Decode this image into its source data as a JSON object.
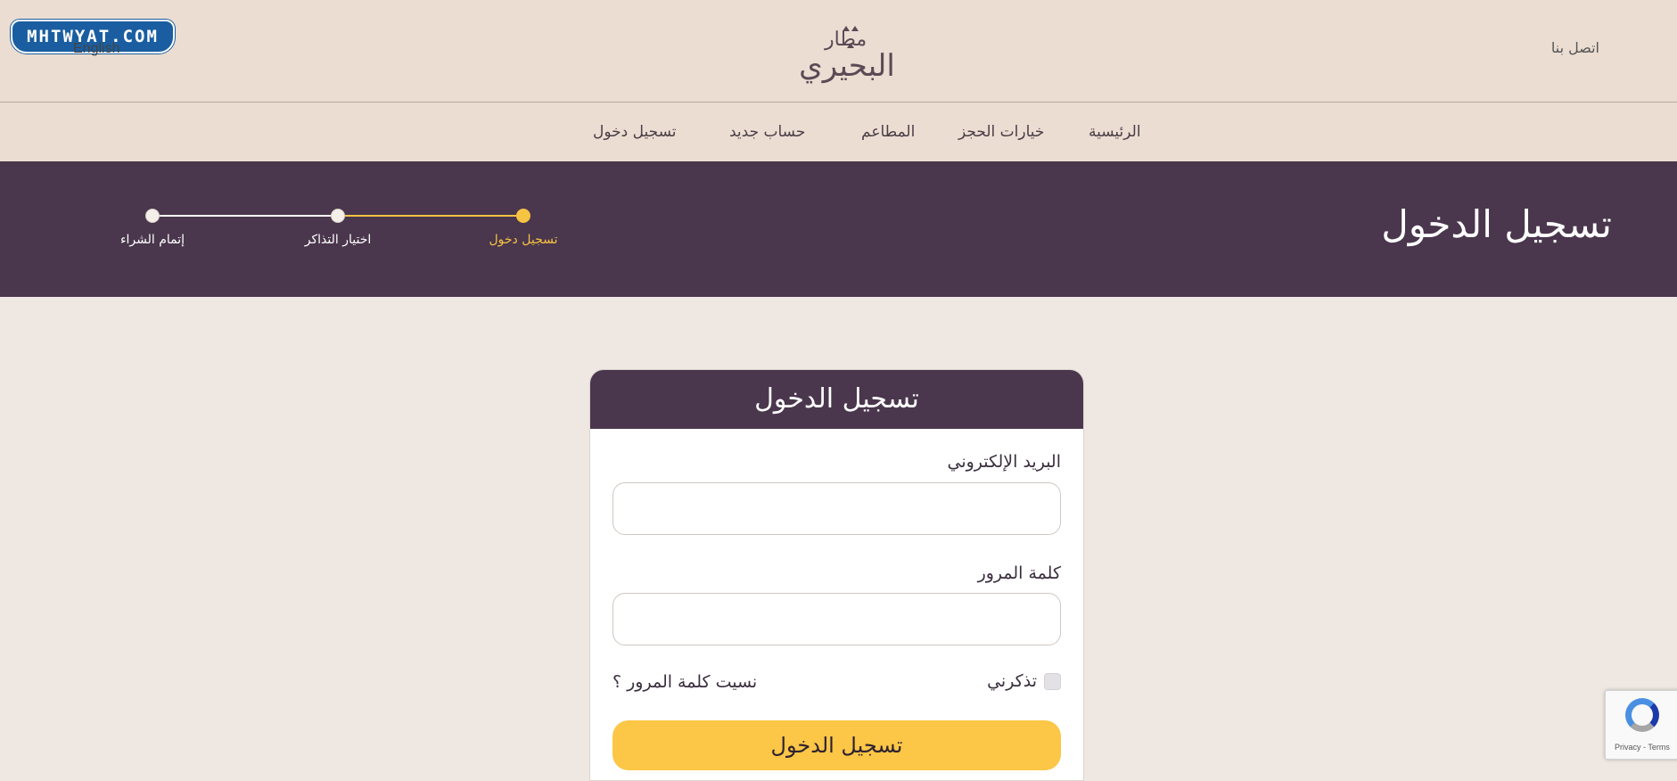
{
  "watermark": {
    "text": "MHTWYAT.COM"
  },
  "header": {
    "language_link": "English",
    "contact_link": "اتصل بنا",
    "logo_small": "مطار",
    "logo_big": "البحيري"
  },
  "nav": {
    "items": [
      {
        "label": "الرئيسية"
      },
      {
        "label": "خيارات الحجز"
      },
      {
        "label": "المطاعم"
      },
      {
        "label": "حساب جديد"
      },
      {
        "label": "تسجيل دخول"
      }
    ]
  },
  "banner": {
    "title": "تسجيل الدخول",
    "steps": [
      {
        "label": "تسجيل دخول",
        "state": "active"
      },
      {
        "label": "اختيار التذاكر",
        "state": "pending"
      },
      {
        "label": "إتمام الشراء",
        "state": "pending"
      }
    ]
  },
  "login_card": {
    "title": "تسجيل الدخول",
    "email_label": "البريد الإلكتروني",
    "email_value": "",
    "password_label": "كلمة المرور",
    "password_value": "",
    "remember_label": "تذكرني",
    "remember_checked": false,
    "forgot_link": "نسيت كلمة المرور ؟",
    "submit_label": "تسجيل الدخول"
  },
  "recaptcha": {
    "terms": "Privacy - Terms"
  },
  "colors": {
    "accent_yellow": "#fcc646",
    "banner_purple": "#4a364d",
    "header_beige": "#ebddd2",
    "page_bg": "#efe8e2"
  }
}
